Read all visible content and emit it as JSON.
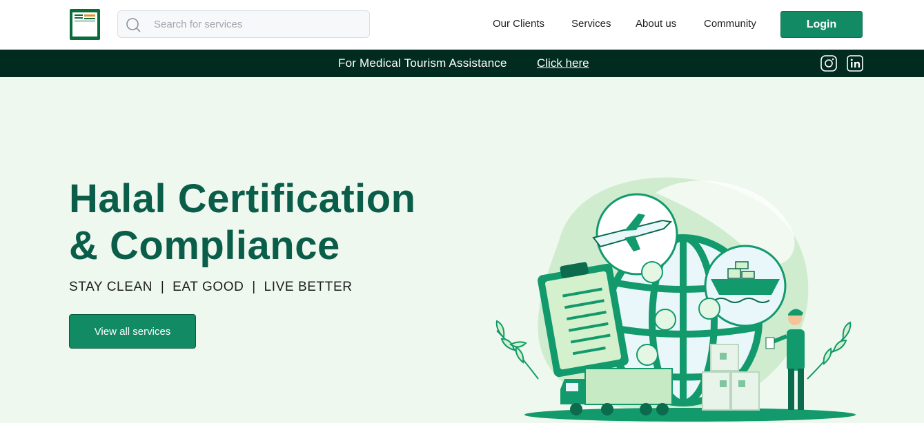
{
  "header": {
    "logo_name": "brand-logo",
    "search": {
      "placeholder": "Search for services"
    },
    "nav": [
      {
        "label": "Our Clients"
      },
      {
        "label": "Services"
      },
      {
        "label": "About us"
      },
      {
        "label": "Community"
      }
    ],
    "login_label": "Login"
  },
  "banner": {
    "text": "For Medical Tourism Assistance",
    "link_label": "Click here",
    "social_icons": [
      "instagram-icon",
      "linkedin-icon"
    ]
  },
  "hero": {
    "title_line1": "Halal Certification",
    "title_line2": "& Compliance",
    "tagline": "STAY CLEAN  |  EAT GOOD  |  LIVE BETTER",
    "cta_label": "View all services"
  },
  "colors": {
    "accent": "#128a64",
    "banner_bg": "#022b20",
    "hero_bg": "#eef8ee",
    "title": "#0a5d49"
  }
}
